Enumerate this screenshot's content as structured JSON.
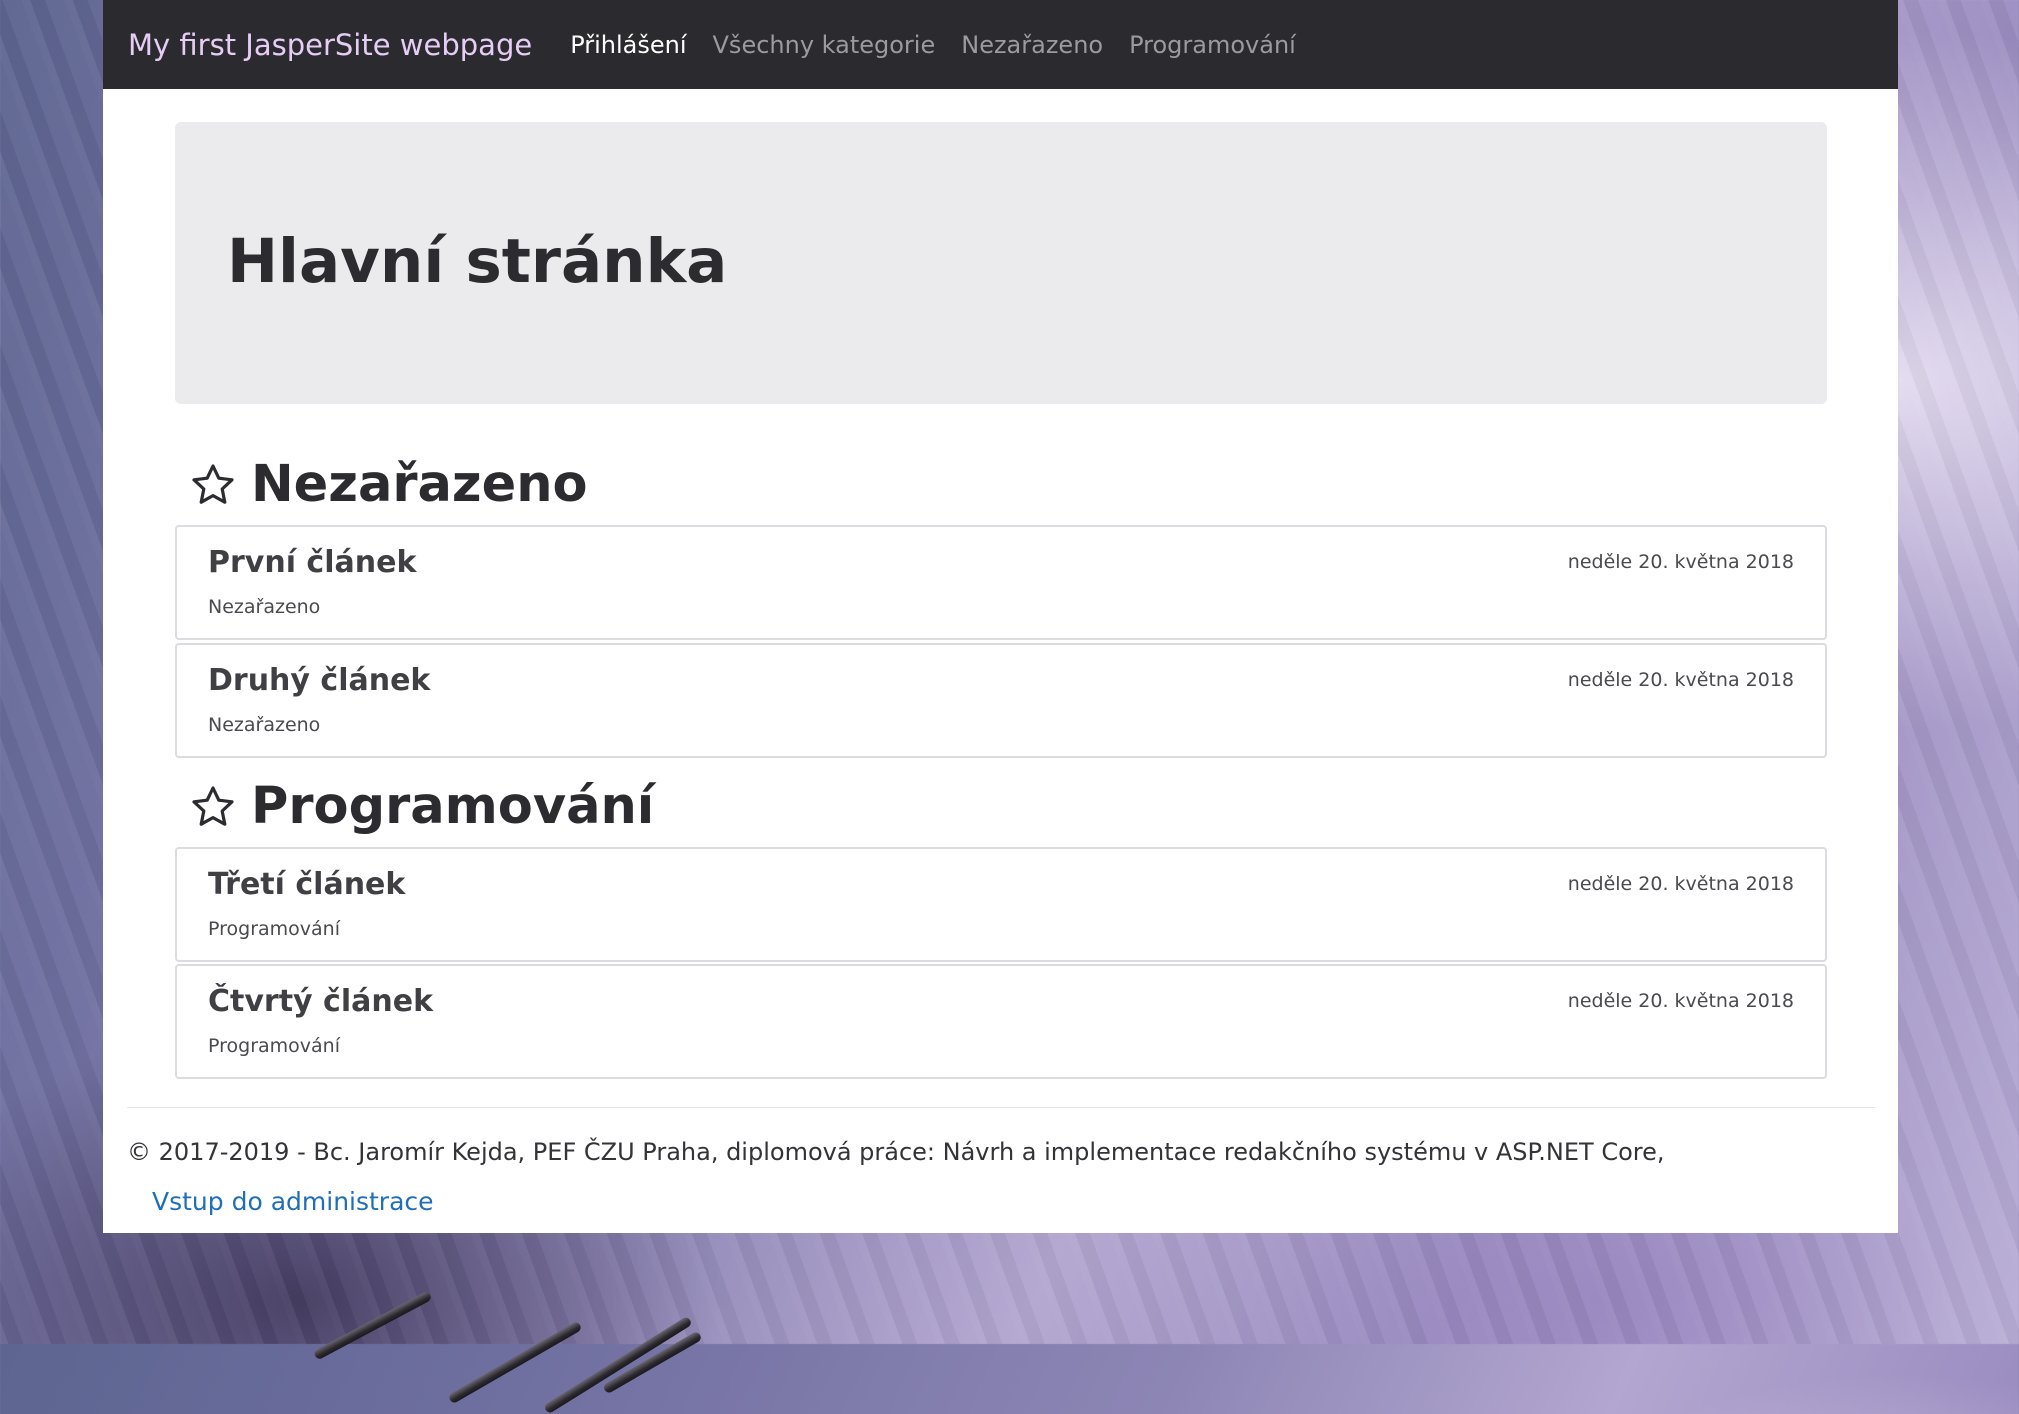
{
  "navbar": {
    "brand": "My first JasperSite webpage",
    "links": [
      "Přihlášení",
      "Všechny kategorie",
      "Nezařazeno",
      "Programování"
    ]
  },
  "jumbotron": {
    "title": "Hlavní stránka"
  },
  "sections": [
    {
      "title": "Nezařazeno",
      "icon": "star-outline-icon",
      "articles": [
        {
          "title": "První článek",
          "category": "Nezařazeno",
          "date": "neděle 20. května 2018"
        },
        {
          "title": "Druhý článek",
          "category": "Nezařazeno",
          "date": "neděle 20. května 2018"
        }
      ]
    },
    {
      "title": "Programování",
      "icon": "star-outline-icon",
      "articles": [
        {
          "title": "Třetí článek",
          "category": "Programování",
          "date": "neděle 20. května 2018"
        },
        {
          "title": "Čtvrtý článek",
          "category": "Programování",
          "date": "neděle 20. května 2018"
        }
      ]
    }
  ],
  "footer": {
    "text": "© 2017-2019 - Bc. Jaromír Kejda, PEF ČZU Praha, diplomová práce: Návrh a implementace redakčního systému v ASP.NET Core,",
    "admin_link": "Vstup do administrace"
  },
  "colors": {
    "navbar": "#2a2a2f",
    "brand": "#e6cdf5",
    "link": "#1f6fb8",
    "jumbotron": "#ebebee"
  }
}
